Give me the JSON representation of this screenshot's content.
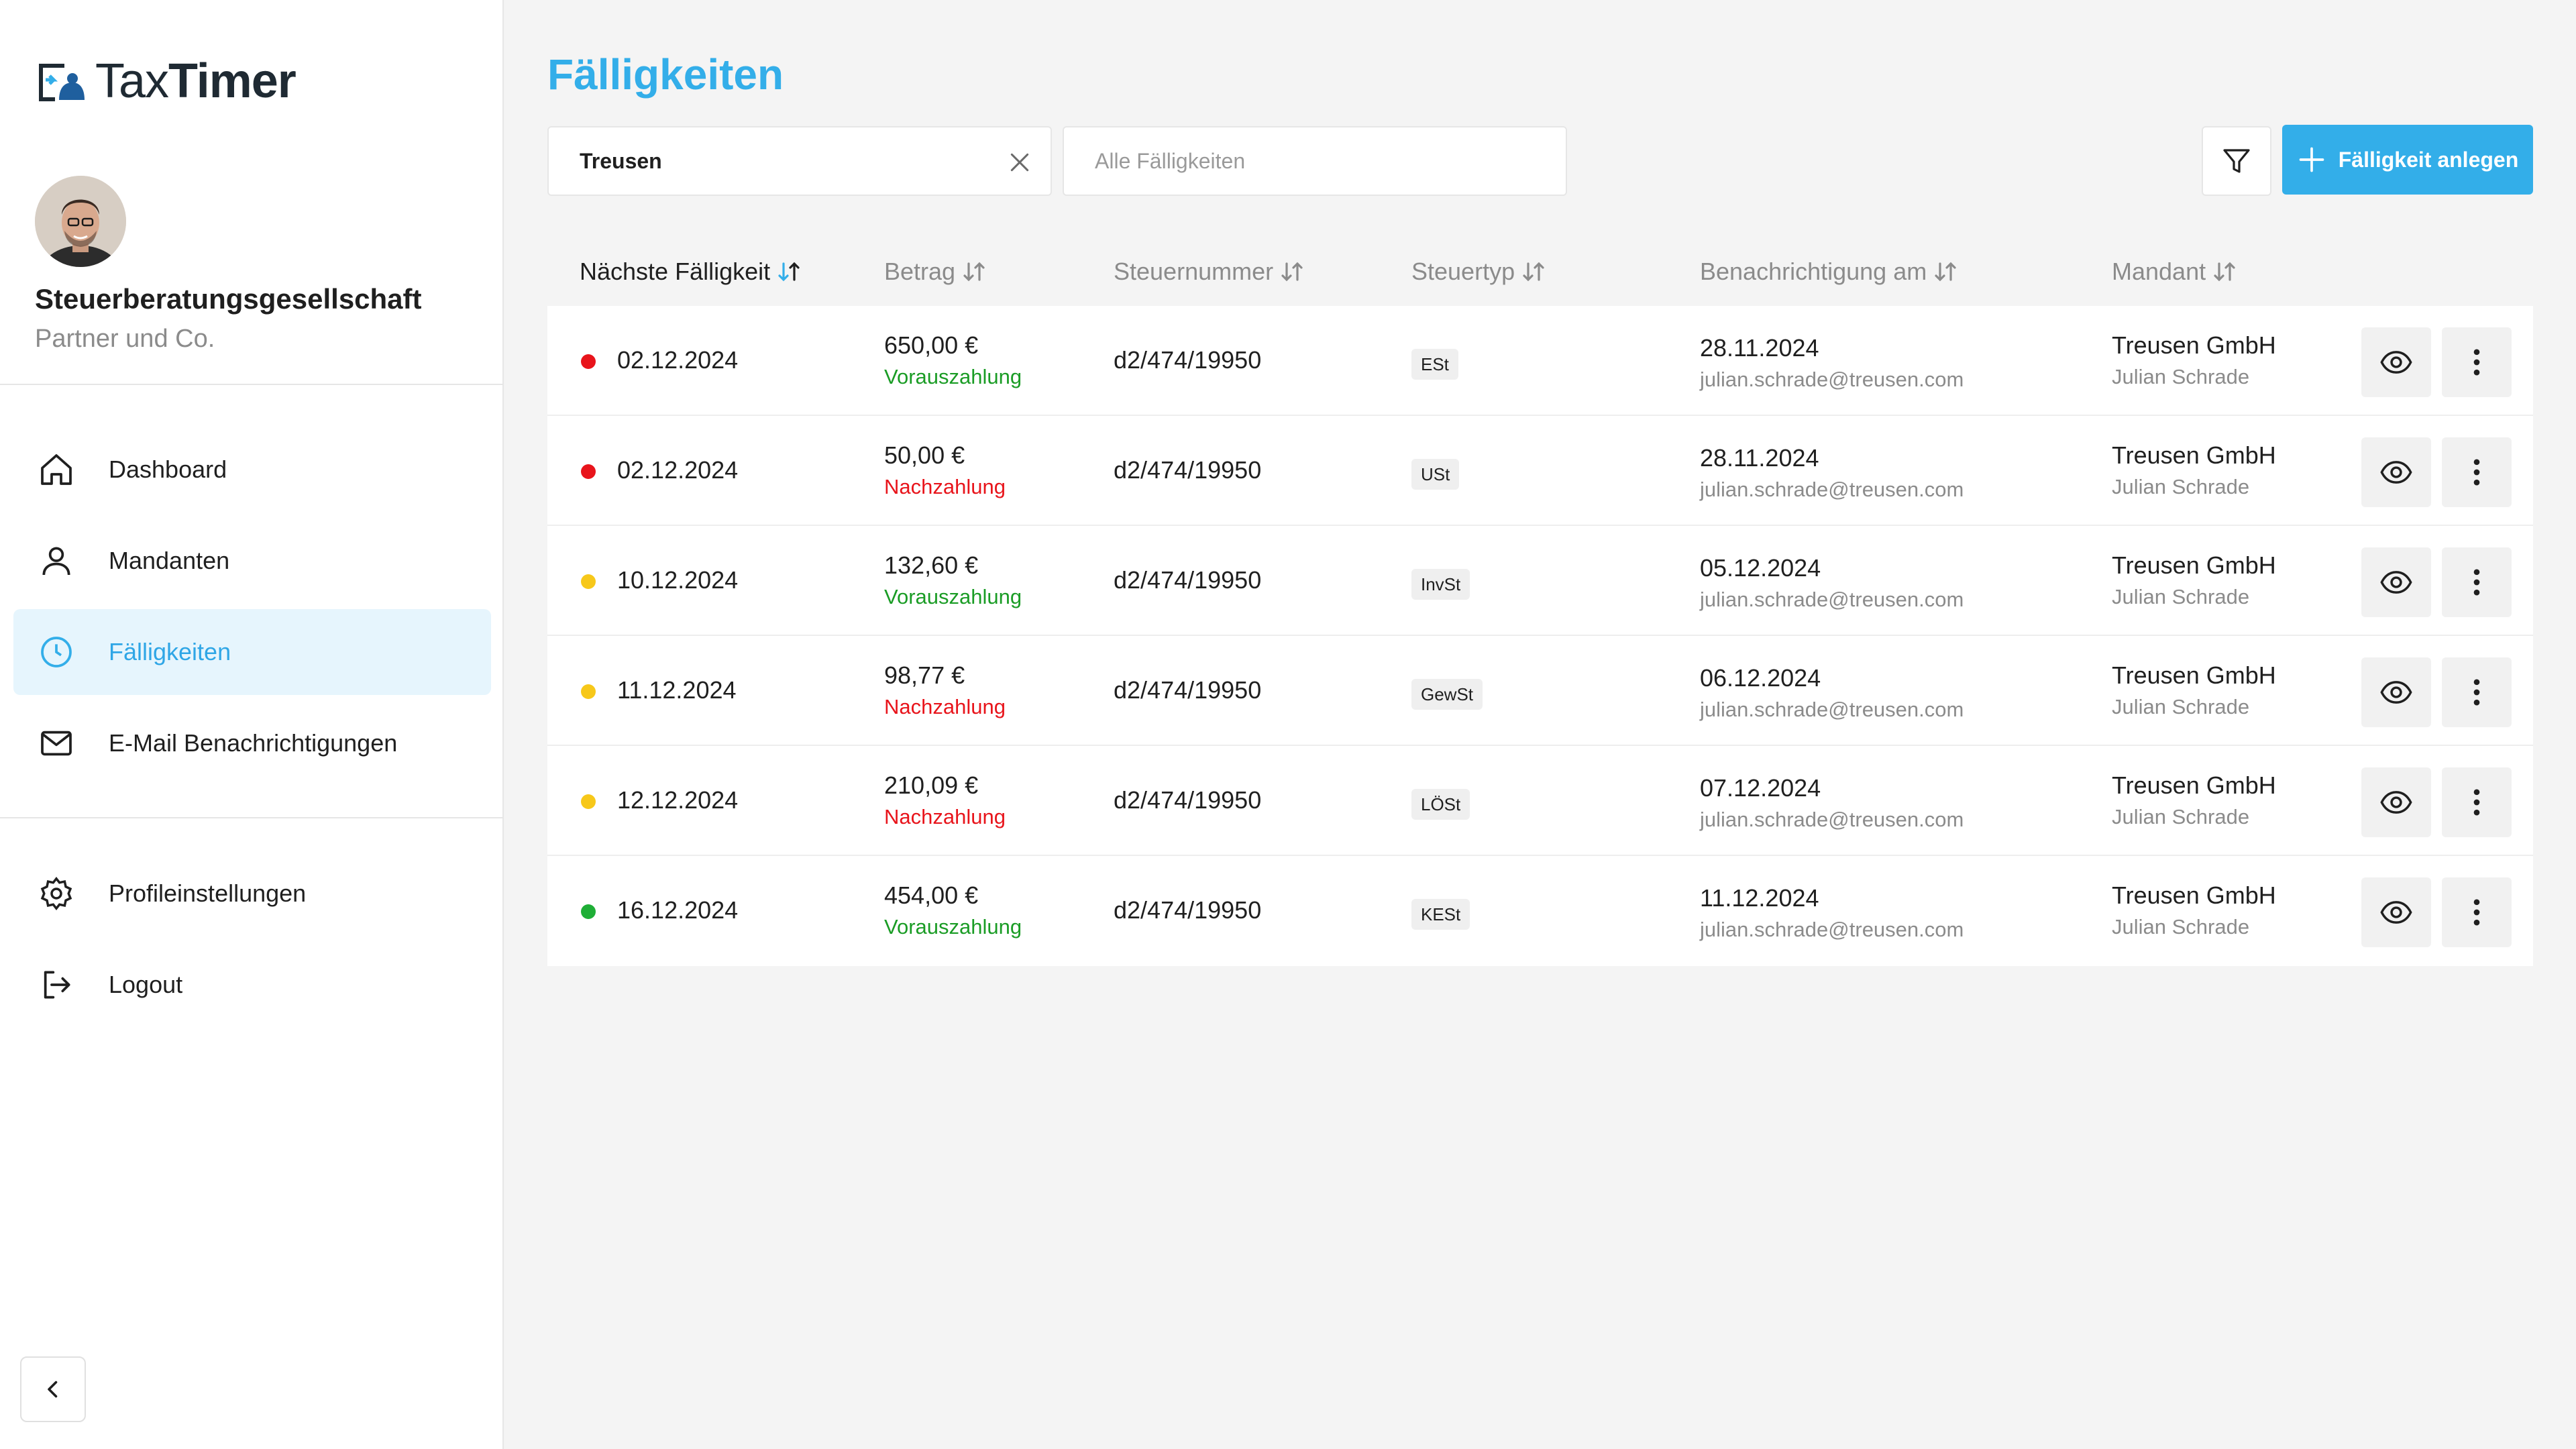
{
  "app": {
    "brand_light": "Tax",
    "brand_bold": "Timer",
    "accent": "#33aee9"
  },
  "sidebar": {
    "org_name": "Steuerberatungsgesellschaft",
    "org_sub": "Partner und Co.",
    "nav": [
      {
        "label": "Dashboard",
        "icon": "home-icon"
      },
      {
        "label": "Mandanten",
        "icon": "user-icon"
      },
      {
        "label": "Fälligkeiten",
        "icon": "clock-icon",
        "active": true
      },
      {
        "label": "E-Mail Benachrichtigungen",
        "icon": "mail-icon"
      }
    ],
    "settings": [
      {
        "label": "Profileinstellungen",
        "icon": "gear-icon"
      },
      {
        "label": "Logout",
        "icon": "logout-icon"
      }
    ]
  },
  "main": {
    "title": "Fälligkeiten",
    "search_value": "Treusen",
    "filter_select_placeholder": "Alle Fälligkeiten",
    "add_button_label": "Fälligkeit anlegen"
  },
  "table": {
    "columns": [
      "Nächste Fälligkeit",
      "Betrag",
      "Steuernummer",
      "Steuertyp",
      "Benachrichtigung am",
      "Mandant"
    ],
    "status_colors": {
      "red": "#e8141b",
      "yellow": "#f7c81a",
      "green": "#1fae36"
    },
    "payment_colors": {
      "Vorauszahlung": "#1a9c25",
      "Nachzahlung": "#e8141b"
    },
    "rows": [
      {
        "status": "red",
        "date": "02.12.2024",
        "amount": "650,00 €",
        "payment_type": "Vorauszahlung",
        "tax_number": "d2/474/19950",
        "tax_type": "ESt",
        "notify_date": "28.11.2024",
        "notify_email": "julian.schrade@treusen.com",
        "client": "Treusen GmbH",
        "contact": "Julian Schrade"
      },
      {
        "status": "red",
        "date": "02.12.2024",
        "amount": "50,00 €",
        "payment_type": "Nachzahlung",
        "tax_number": "d2/474/19950",
        "tax_type": "USt",
        "notify_date": "28.11.2024",
        "notify_email": "julian.schrade@treusen.com",
        "client": "Treusen GmbH",
        "contact": "Julian Schrade"
      },
      {
        "status": "yellow",
        "date": "10.12.2024",
        "amount": "132,60 €",
        "payment_type": "Vorauszahlung",
        "tax_number": "d2/474/19950",
        "tax_type": "InvSt",
        "notify_date": "05.12.2024",
        "notify_email": "julian.schrade@treusen.com",
        "client": "Treusen GmbH",
        "contact": "Julian Schrade"
      },
      {
        "status": "yellow",
        "date": "11.12.2024",
        "amount": "98,77 €",
        "payment_type": "Nachzahlung",
        "tax_number": "d2/474/19950",
        "tax_type": "GewSt",
        "notify_date": "06.12.2024",
        "notify_email": "julian.schrade@treusen.com",
        "client": "Treusen GmbH",
        "contact": "Julian Schrade"
      },
      {
        "status": "yellow",
        "date": "12.12.2024",
        "amount": "210,09 €",
        "payment_type": "Nachzahlung",
        "tax_number": "d2/474/19950",
        "tax_type": "LÖSt",
        "notify_date": "07.12.2024",
        "notify_email": "julian.schrade@treusen.com",
        "client": "Treusen GmbH",
        "contact": "Julian Schrade"
      },
      {
        "status": "green",
        "date": "16.12.2024",
        "amount": "454,00 €",
        "payment_type": "Vorauszahlung",
        "tax_number": "d2/474/19950",
        "tax_type": "KESt",
        "notify_date": "11.12.2024",
        "notify_email": "julian.schrade@treusen.com",
        "client": "Treusen GmbH",
        "contact": "Julian Schrade"
      }
    ]
  }
}
